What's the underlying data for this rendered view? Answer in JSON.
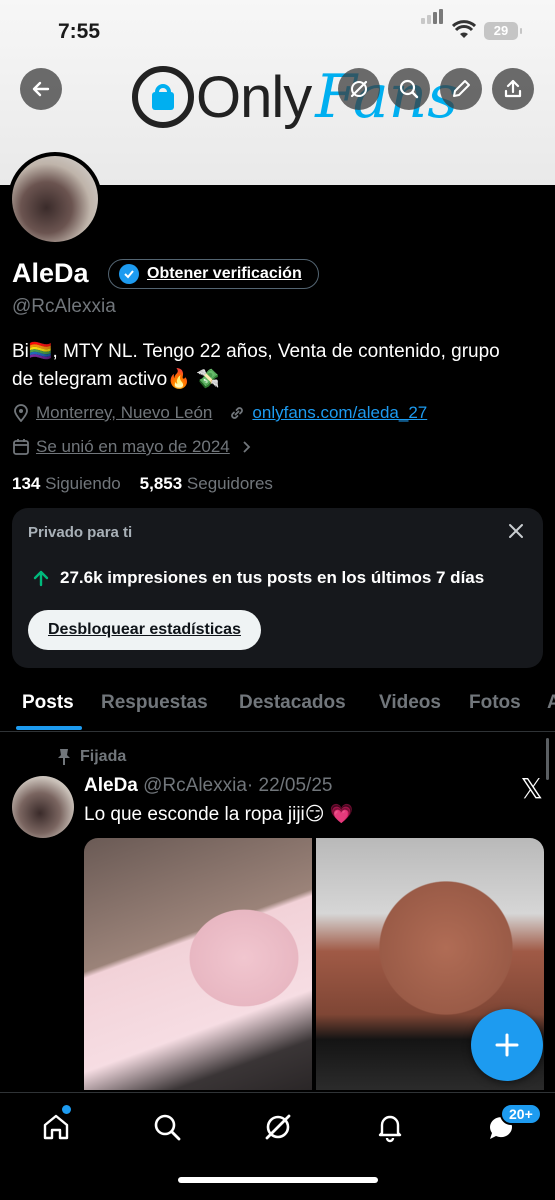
{
  "status_bar": {
    "time": "7:55",
    "battery": "29"
  },
  "header": {
    "logo": {
      "part1": "Only",
      "part2": "Fans"
    },
    "icons": [
      "back-arrow-icon",
      "grok-icon",
      "search-icon",
      "edit-icon",
      "share-icon"
    ]
  },
  "profile": {
    "name": "AleDa",
    "verify_label": "Obtener verificación",
    "handle": "@RcAlexxia",
    "bio_line1": "Bi🏳️‍🌈, MTY NL. Tengo 22 años, Venta de contenido, grupo",
    "bio_line2": "de telegram activo🔥 💸",
    "location": "Monterrey, Nuevo León",
    "website": "onlyfans.com/aleda_27",
    "joined": "Se unió en mayo de 2024",
    "following_count": "134",
    "following_label": "Siguiendo",
    "followers_count": "5,853",
    "followers_label": "Seguidores"
  },
  "private_card": {
    "title": "Privado para ti",
    "stat": "27.6k impresiones en tus posts en los últimos 7 días",
    "button": "Desbloquear estadísticas"
  },
  "tabs": [
    "Posts",
    "Respuestas",
    "Destacados",
    "Videos",
    "Fotos",
    "A"
  ],
  "post": {
    "pinned_label": "Fijada",
    "author": "AleDa",
    "handle": "@RcAlexxia",
    "date": "· 22/05/25",
    "text": "Lo que esconde la ropa jiji😏 💗",
    "x_logo": "𝕏"
  },
  "bottom_nav": {
    "items": [
      "home-icon",
      "search-icon",
      "grok-icon",
      "notifications-icon",
      "messages-icon"
    ],
    "messages_badge": "20+"
  },
  "colors": {
    "accent": "#1d9bf0",
    "background": "#000000",
    "muted": "#71767b",
    "onlyfans_blue": "#00aff0"
  }
}
